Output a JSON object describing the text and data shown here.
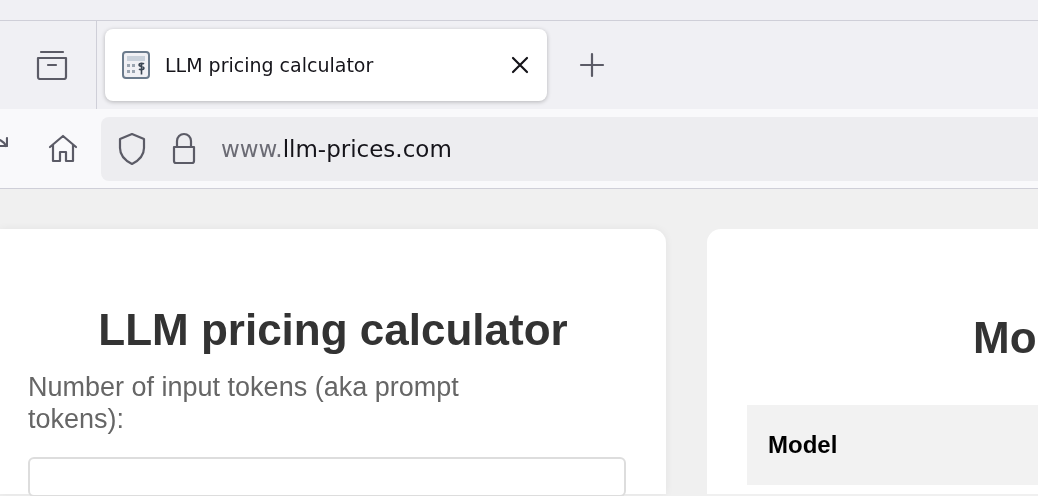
{
  "tabs": [
    {
      "title": "LLM pricing calculator",
      "selected": true
    }
  ],
  "address_bar": {
    "prefix": "www.",
    "domain": "llm-prices.com"
  },
  "calculator": {
    "title": "LLM pricing calculator",
    "input_label": "Number of input tokens (aka prompt tokens):"
  },
  "models": {
    "title": "Mo",
    "columns": [
      "Model"
    ]
  }
}
